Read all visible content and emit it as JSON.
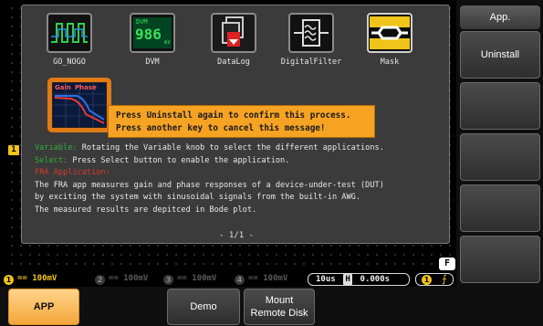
{
  "screen": {
    "top_right_glyph": "n",
    "ch1_marker": "1",
    "cursor_label": "F"
  },
  "apps": [
    {
      "label": "GO_NOGO",
      "icon": "go-nogo-icon"
    },
    {
      "label": "DVM",
      "icon": "dvm-icon",
      "icon_text_top": "DVM",
      "icon_text_value": "986",
      "icon_text_unit": "mV"
    },
    {
      "label": "DataLog",
      "icon": "datalog-icon"
    },
    {
      "label": "DigitalFilter",
      "icon": "digital-filter-icon"
    },
    {
      "label": "Mask",
      "icon": "mask-icon"
    }
  ],
  "fra_app": {
    "icon": "fra-bode-icon",
    "gain_label": "Gain",
    "phase_label": "Phase"
  },
  "confirm": {
    "line1": "Press Uninstall again to confirm this process.",
    "line2": "Press another key to cancel this message!"
  },
  "description": {
    "variable_label": "Variable:",
    "variable_text": " Rotating the Variable knob to select the different applications.",
    "select_label": "Select:",
    "select_text": " Press Select button to enable the application.",
    "fra_heading": "FRA Application:",
    "line1": "The FRA app measures gain and phase responses of a device-under-test (DUT)",
    "line2": "by exciting the system with sinusoidal signals from the built-in AWG.",
    "line3": "The measured results are depitced in Bode plot.",
    "page_indicator": "- 1/1 -"
  },
  "status": {
    "channels": [
      {
        "num": "1",
        "text": "== 100mV",
        "color": "#f0c419"
      },
      {
        "num": "2",
        "text": "== 100mV",
        "color": "#5a5a5a"
      },
      {
        "num": "3",
        "text": "== 100mV",
        "color": "#5a5a5a"
      },
      {
        "num": "4",
        "text": "== 100mV",
        "color": "#5a5a5a"
      }
    ],
    "timebase": "10us",
    "time_icon": "H",
    "time_offset": "0.000s",
    "trigger_source": "1"
  },
  "side_menu": {
    "title": "App.",
    "buttons": [
      "Uninstall",
      "",
      "",
      "",
      ""
    ]
  },
  "bottom_menu": {
    "buttons": [
      {
        "label": "APP",
        "active": true
      },
      {
        "label": "Demo",
        "active": false
      },
      {
        "label": "Mount Remote Disk",
        "active": false
      }
    ]
  }
}
